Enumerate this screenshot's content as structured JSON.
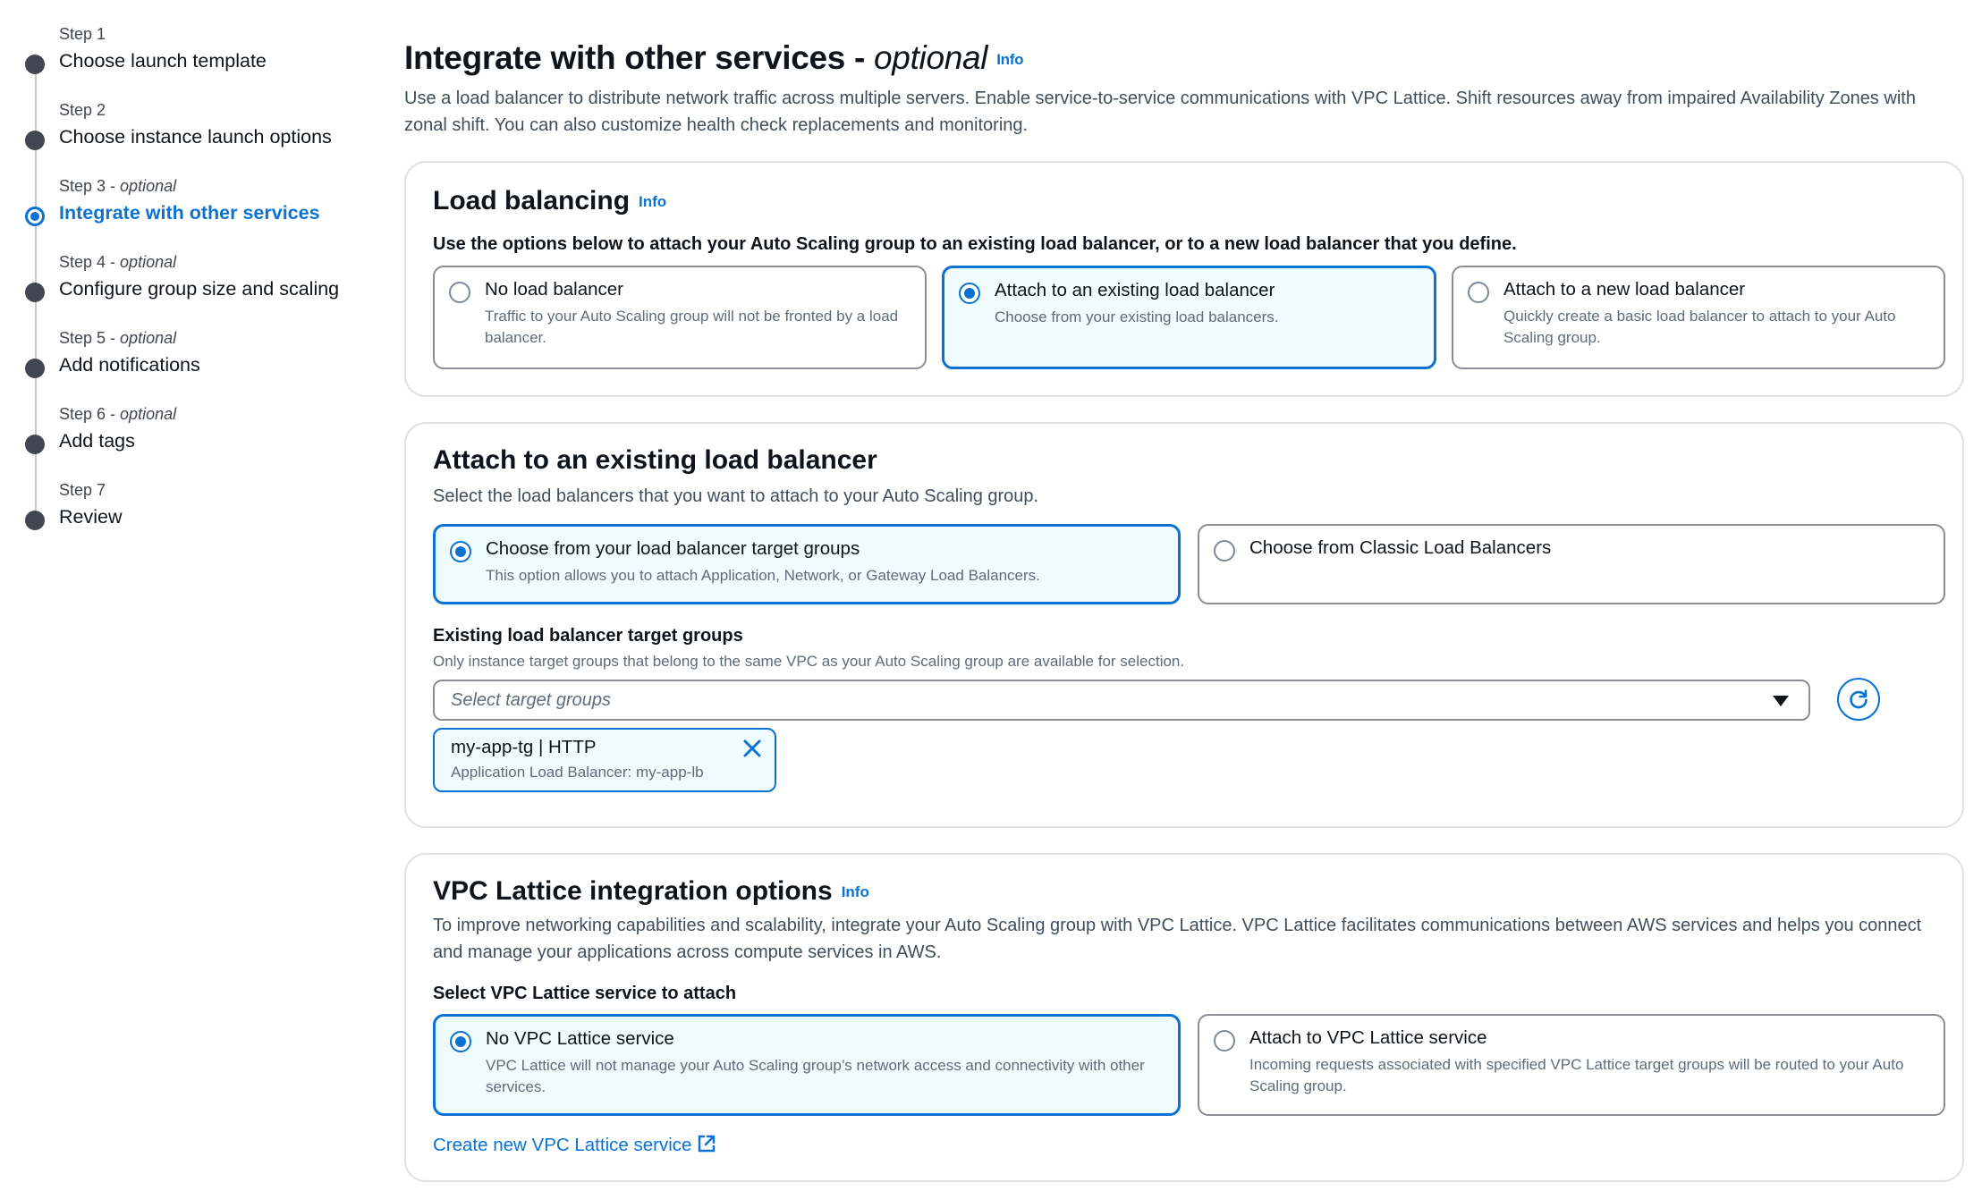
{
  "steps": [
    {
      "caption": "Step 1",
      "optional": "",
      "label": "Choose launch template"
    },
    {
      "caption": "Step 2",
      "optional": "",
      "label": "Choose instance launch options"
    },
    {
      "caption": "Step 3 - ",
      "optional": "optional",
      "label": "Integrate with other services"
    },
    {
      "caption": "Step 4 - ",
      "optional": "optional",
      "label": "Configure group size and scaling"
    },
    {
      "caption": "Step 5 - ",
      "optional": "optional",
      "label": "Add notifications"
    },
    {
      "caption": "Step 6 - ",
      "optional": "optional",
      "label": "Add tags"
    },
    {
      "caption": "Step 7",
      "optional": "",
      "label": "Review"
    }
  ],
  "header": {
    "title": "Integrate with other services - ",
    "title_optional": "optional",
    "info": "Info",
    "description": "Use a load balancer to distribute network traffic across multiple servers. Enable service-to-service communications with VPC Lattice. Shift resources away from impaired Availability Zones with zonal shift. You can also customize health check replacements and monitoring."
  },
  "load_balancing": {
    "title": "Load balancing",
    "info": "Info",
    "instruction": "Use the options below to attach your Auto Scaling group to an existing load balancer, or to a new load balancer that you define.",
    "options": [
      {
        "title": "No load balancer",
        "desc": "Traffic to your Auto Scaling group will not be fronted by a load balancer."
      },
      {
        "title": "Attach to an existing load balancer",
        "desc": "Choose from your existing load balancers."
      },
      {
        "title": "Attach to a new load balancer",
        "desc": "Quickly create a basic load balancer to attach to your Auto Scaling group."
      }
    ],
    "selected_index": 1
  },
  "attach_existing": {
    "title": "Attach to an existing load balancer",
    "description": "Select the load balancers that you want to attach to your Auto Scaling group.",
    "options": [
      {
        "title": "Choose from your load balancer target groups",
        "desc": "This option allows you to attach Application, Network, or Gateway Load Balancers."
      },
      {
        "title": "Choose from Classic Load Balancers",
        "desc": ""
      }
    ],
    "selected_index": 0,
    "field_label": "Existing load balancer target groups",
    "field_hint": "Only instance target groups that belong to the same VPC as your Auto Scaling group are available for selection.",
    "select_placeholder": "Select target groups",
    "token": {
      "title": "my-app-tg | HTTP",
      "subtitle": "Application Load Balancer: my-app-lb"
    }
  },
  "vpc_lattice": {
    "title": "VPC Lattice integration options",
    "info": "Info",
    "description": "To improve networking capabilities and scalability, integrate your Auto Scaling group with VPC Lattice. VPC Lattice facilitates communications between AWS services and helps you connect and manage your applications across compute services in AWS.",
    "field_label": "Select VPC Lattice service to attach",
    "options": [
      {
        "title": "No VPC Lattice service",
        "desc": "VPC Lattice will not manage your Auto Scaling group’s network access and connectivity with other services."
      },
      {
        "title": "Attach to VPC Lattice service",
        "desc": "Incoming requests associated with specified VPC Lattice target groups will be routed to your Auto Scaling group."
      }
    ],
    "selected_index": 0,
    "create_link": "Create new VPC Lattice service"
  },
  "colors": {
    "accent": "#0972d3",
    "selected_bg": "#f0fbff",
    "border": "#8c8c94"
  }
}
